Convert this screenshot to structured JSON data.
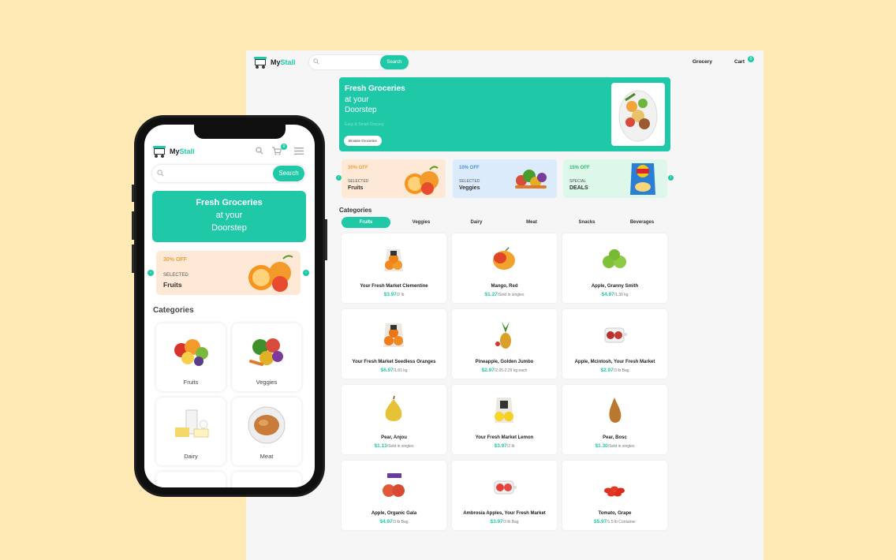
{
  "brand": {
    "name_prefix": "My",
    "name_suffix": "Stall"
  },
  "colors": {
    "accent": "#1fc9a8",
    "background": "#ffe9b4"
  },
  "desktop": {
    "search": {
      "placeholder": "",
      "button_label": "Search"
    },
    "nav": {
      "grocery_label": "Grocery",
      "cart_label": "Cart",
      "cart_count": "0"
    },
    "hero": {
      "title_line1": "Fresh Groceries",
      "title_line2": "at your",
      "title_line3": "Doorstep",
      "tagline": "Easy & Smart Grocery",
      "button_label": "Browse Groceries"
    },
    "promos": [
      {
        "discount": "30% OFF",
        "label": "SELECTED",
        "name": "Fruits",
        "bg": "#fde9d6",
        "accent": "#f0a044"
      },
      {
        "discount": "10% OFF",
        "label": "SELECTED",
        "name": "Veggies",
        "bg": "#dcebfb",
        "accent": "#4a90d9"
      },
      {
        "discount": "15% OFF",
        "label": "SPECIAL",
        "name": "DEALS",
        "bg": "#ddf7ea",
        "accent": "#2fbb6b"
      }
    ],
    "categories_title": "Categories",
    "tabs": [
      "Fruits",
      "Veggies",
      "Dairy",
      "Meat",
      "Snacks",
      "Beverages"
    ],
    "active_tab": "Fruits",
    "products": [
      {
        "name": "Your Fresh Market Clementine",
        "price": "$3.97",
        "unit": "/2 lb",
        "icon": "clementine-bag-icon"
      },
      {
        "name": "Mango, Red",
        "price": "$1.27",
        "unit": "/Sold in singles",
        "icon": "mango-icon"
      },
      {
        "name": "Apple, Granny Smith",
        "price": "$4.97",
        "unit": "/1.36 kg",
        "icon": "green-apples-icon"
      },
      {
        "name": "Your Fresh Market Seedless Oranges",
        "price": "$6.97",
        "unit": "/1.81 kg",
        "icon": "oranges-bag-icon"
      },
      {
        "name": "Pineapple, Golden Jumbo",
        "price": "$2.97",
        "unit": "/2.05-2.29 kg each",
        "icon": "pineapple-icon"
      },
      {
        "name": "Apple, Mcintosh, Your Fresh Market",
        "price": "$2.97",
        "unit": "/3 lb Bag",
        "icon": "apple-bag-icon"
      },
      {
        "name": "Pear, Anjou",
        "price": "$1.13",
        "unit": "/Sold in singles",
        "icon": "pear-icon"
      },
      {
        "name": "Your Fresh Market Lemon",
        "price": "$3.97",
        "unit": "/2 lb",
        "icon": "lemon-bag-icon"
      },
      {
        "name": "Pear, Bosc",
        "price": "$1.30",
        "unit": "/Sold in singles",
        "icon": "bosc-pear-icon"
      },
      {
        "name": "Apple, Organic Gala",
        "price": "$4.97",
        "unit": "/3 lb Bag",
        "icon": "gala-apples-icon"
      },
      {
        "name": "Ambrosia Apples, Your Fresh Market",
        "price": "$3.97",
        "unit": "/3 lb Bag",
        "icon": "ambrosia-bag-icon"
      },
      {
        "name": "Tomato, Grape",
        "price": "$5.97",
        "unit": "/1.5 lb Container",
        "icon": "grape-tomatoes-icon"
      }
    ]
  },
  "mobile": {
    "search": {
      "placeholder": "",
      "button_label": "Search"
    },
    "cart_count": "0",
    "hero": {
      "title_line1": "Fresh Groceries",
      "title_line2": "at your",
      "title_line3": "Doorstep"
    },
    "promo": {
      "discount": "30% OFF",
      "label": "SELECTED",
      "name": "Fruits"
    },
    "categories_title": "Categories",
    "categories": [
      {
        "label": "Fruits",
        "icon": "fruits-icon"
      },
      {
        "label": "Veggies",
        "icon": "veggies-icon"
      },
      {
        "label": "Dairy",
        "icon": "dairy-icon"
      },
      {
        "label": "Meat",
        "icon": "meat-icon"
      }
    ]
  }
}
